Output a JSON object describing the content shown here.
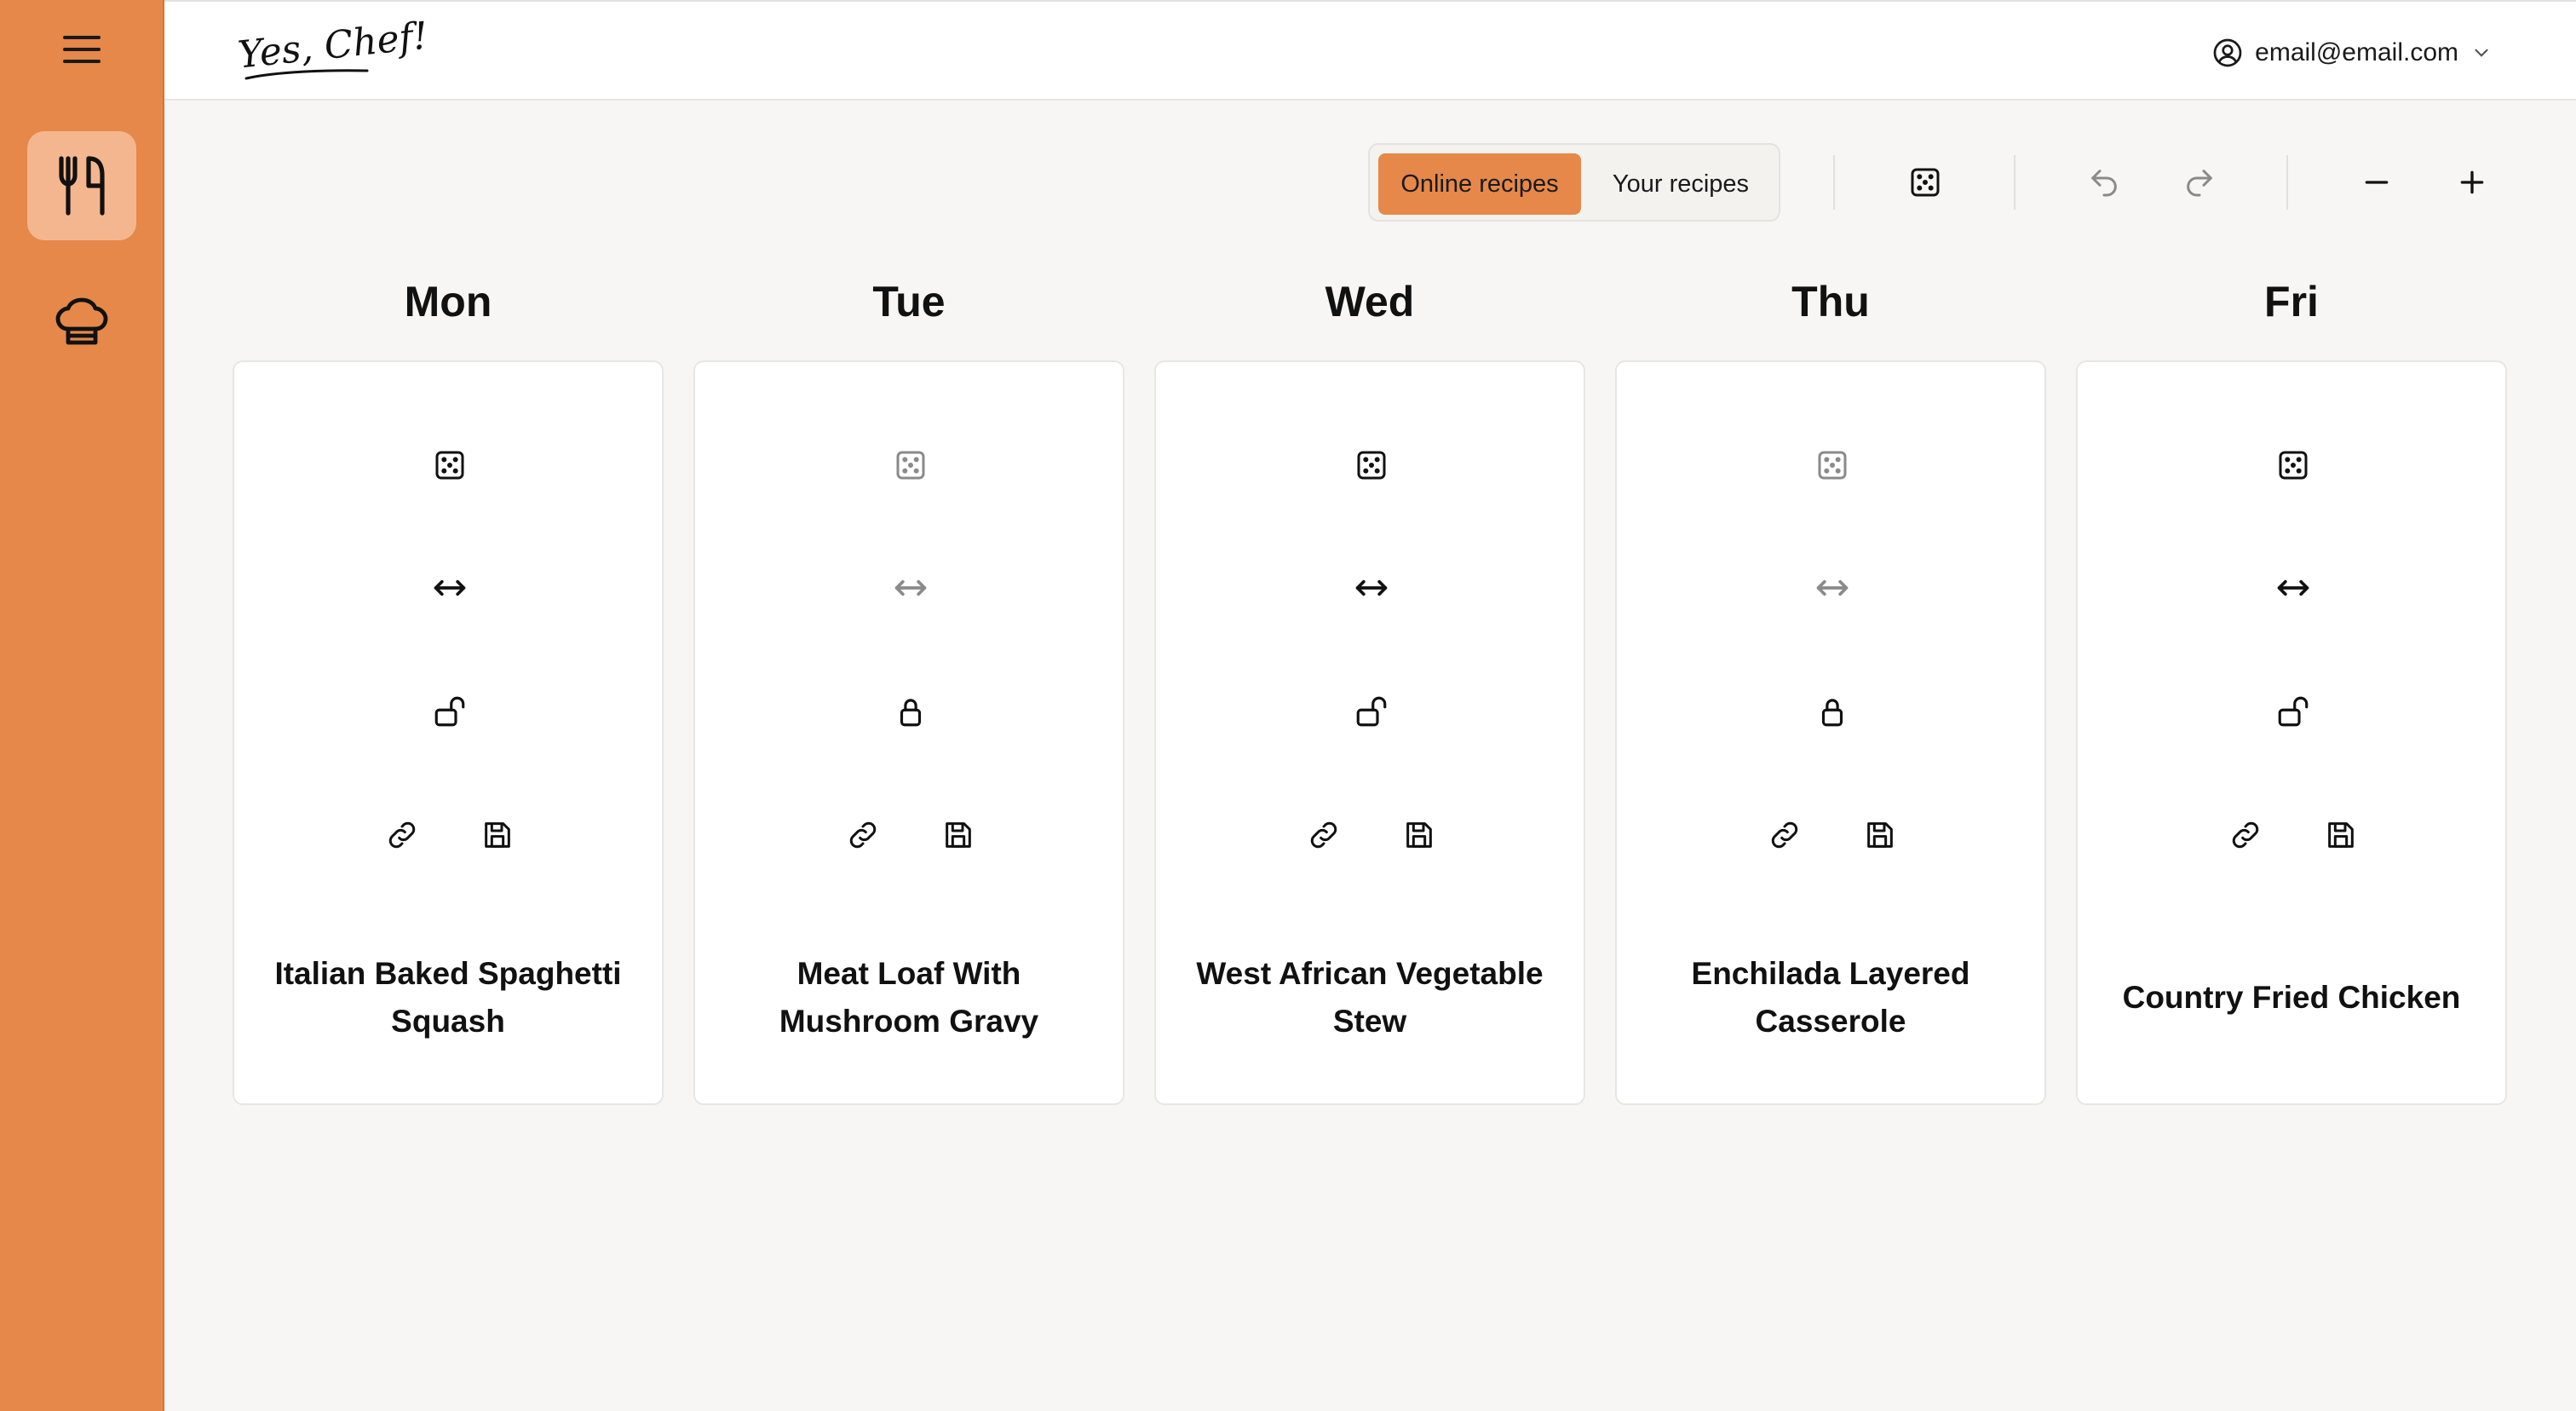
{
  "app": {
    "logo_text": "Yes, Chef!",
    "accent_color": "#e5884a"
  },
  "sidebar": {
    "menu_icon": "hamburger-menu-icon",
    "items": [
      {
        "icon": "fork-knife-icon",
        "active": true
      },
      {
        "icon": "chef-hat-icon",
        "active": false
      }
    ]
  },
  "header": {
    "user_email": "email@email.com",
    "user_icon": "user-circle-icon",
    "dropdown_icon": "chevron-down-icon"
  },
  "toolbar": {
    "source_options": [
      {
        "label": "Online recipes",
        "selected": true
      },
      {
        "label": "Your recipes",
        "selected": false
      }
    ],
    "icons": [
      "dice-icon",
      "undo-icon",
      "redo-icon",
      "minus-icon",
      "plus-icon"
    ]
  },
  "days": [
    {
      "day": "Mon",
      "recipe": "Italian Baked Spaghetti Squash",
      "locked": false
    },
    {
      "day": "Tue",
      "recipe": "Meat Loaf With Mushroom Gravy",
      "locked": true
    },
    {
      "day": "Wed",
      "recipe": "West African Vegetable Stew",
      "locked": false
    },
    {
      "day": "Thu",
      "recipe": "Enchilada Layered Casserole",
      "locked": true
    },
    {
      "day": "Fri",
      "recipe": "Country Fried Chicken",
      "locked": false
    }
  ]
}
